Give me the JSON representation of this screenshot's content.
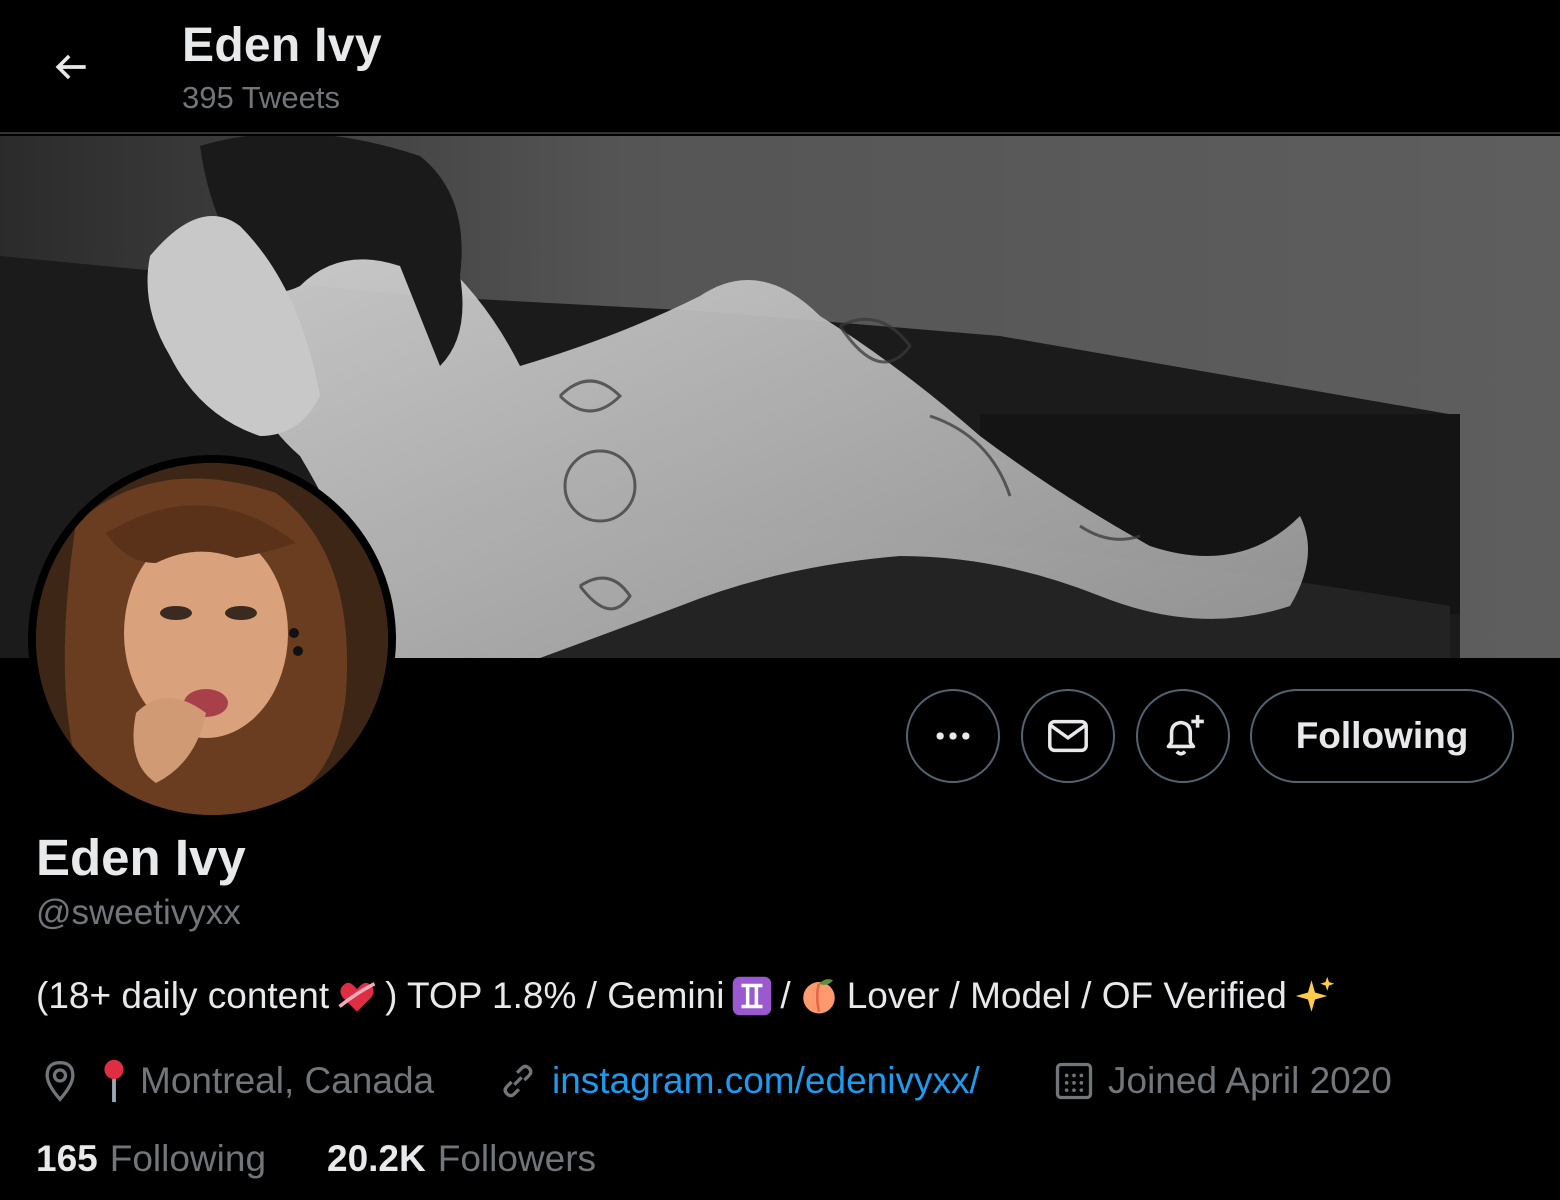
{
  "header": {
    "title": "Eden Ivy",
    "tweet_count": "395 Tweets"
  },
  "profile": {
    "display_name": "Eden Ivy",
    "handle": "@sweetivyxx",
    "follow_button": "Following",
    "bio": {
      "part1": "(18+ daily content",
      "part2": ") TOP 1.8% / Gemini",
      "part3": "/",
      "part4": "Lover / Model / OF Verified"
    },
    "location": "Montreal, Canada",
    "website": "instagram.com/edenivyxx/",
    "joined": "Joined April 2020",
    "following_count": "165",
    "following_label": "Following",
    "followers_count": "20.2K",
    "followers_label": "Followers"
  },
  "icons": [
    "back-arrow-icon",
    "more-icon",
    "mail-icon",
    "notification-bell-plus-icon",
    "location-icon",
    "pin-emoji-icon",
    "link-icon",
    "calendar-icon",
    "heart-emoji-icon",
    "gemini-emoji-icon",
    "peach-emoji-icon",
    "sparkles-emoji-icon"
  ],
  "colors": {
    "background": "#000000",
    "text_primary": "#e7e9ea",
    "text_secondary": "#71767b",
    "link": "#1d9bf0",
    "border": "#536471"
  }
}
